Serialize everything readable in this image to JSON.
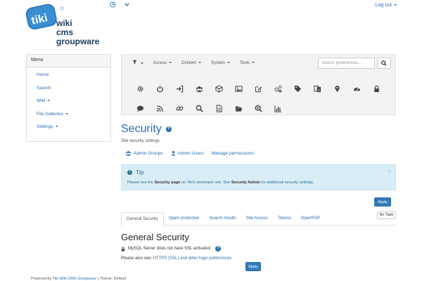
{
  "header": {
    "logo": {
      "alt": "Tiki Wiki CMS Groupware",
      "line1": "wiki",
      "line2": "cms",
      "line3": "groupware",
      "badge": "tiki"
    },
    "icons": [
      {
        "icon": "clock-icon"
      },
      {
        "icon": "chevron-down-icon"
      }
    ],
    "logout_label": "Log out"
  },
  "sidebar": {
    "title": "Menu",
    "items": [
      {
        "label": "Home",
        "has_caret": false
      },
      {
        "label": "Search",
        "has_caret": false
      },
      {
        "label": "Wiki",
        "has_caret": true
      },
      {
        "label": "File Galleries",
        "has_caret": true
      },
      {
        "label": "Settings",
        "has_caret": true
      }
    ]
  },
  "admin_nav": {
    "items": [
      {
        "label": "",
        "icon": "filter-icon"
      },
      {
        "label": "Access"
      },
      {
        "label": "Content"
      },
      {
        "label": "System"
      },
      {
        "label": "Tools"
      }
    ],
    "search_placeholder": "Search preferences...",
    "icons_row1": [
      "gear-icon",
      "power-icon",
      "login-icon",
      "users-icon",
      "cube-icon",
      "image-icon",
      "edit-icon",
      "cogs-icon",
      "tag-icon",
      "language-icon",
      "map-marker-icon",
      "dashboard-icon",
      "lock-icon"
    ],
    "icons_row2": [
      "comment-icon",
      "rss-icon",
      "link-icon",
      "search-icon",
      "file-icon",
      "folder-open-icon",
      "zoom-icon",
      "bar-chart-icon"
    ]
  },
  "page": {
    "title": "Security",
    "subtitle": "Site security settings",
    "quick_links": [
      {
        "label": "Admin Groups",
        "icon": "users-icon"
      },
      {
        "label": "Admin Users",
        "icon": "user-icon"
      },
      {
        "label": "Manage permissions",
        "icon": ""
      }
    ]
  },
  "tip": {
    "title": "Tip",
    "body_1": "Please see the ",
    "body_bold_1": "Security page",
    "body_2": " on Tiki's developer site. See ",
    "body_bold_2": "Security Admin",
    "body_3": " for additional security settings."
  },
  "apply_label": "Apply",
  "no_tabs_label": "No Tabs",
  "tabs": [
    {
      "label": "General Security",
      "active": true
    },
    {
      "label": "Spam protection",
      "active": false
    },
    {
      "label": "Search results",
      "active": false
    },
    {
      "label": "Site Access",
      "active": false
    },
    {
      "label": "Tokens",
      "active": false
    },
    {
      "label": "OpenPGP",
      "active": false
    }
  ],
  "section": {
    "title": "General Security",
    "ssl_warning": "MySQL Server does not have SSL activated",
    "see_also_prefix": "Please also see: ",
    "see_also_link": "HTTPS (SSL) and other login preferences"
  },
  "footer": {
    "prefix": "Powered by ",
    "link": "Tiki Wiki CMS Groupware",
    "suffix": " | Theme: Default"
  },
  "colors": {
    "link": "#2a6db0",
    "primary": "#337ab7",
    "tip_bg": "#d9edf7"
  }
}
